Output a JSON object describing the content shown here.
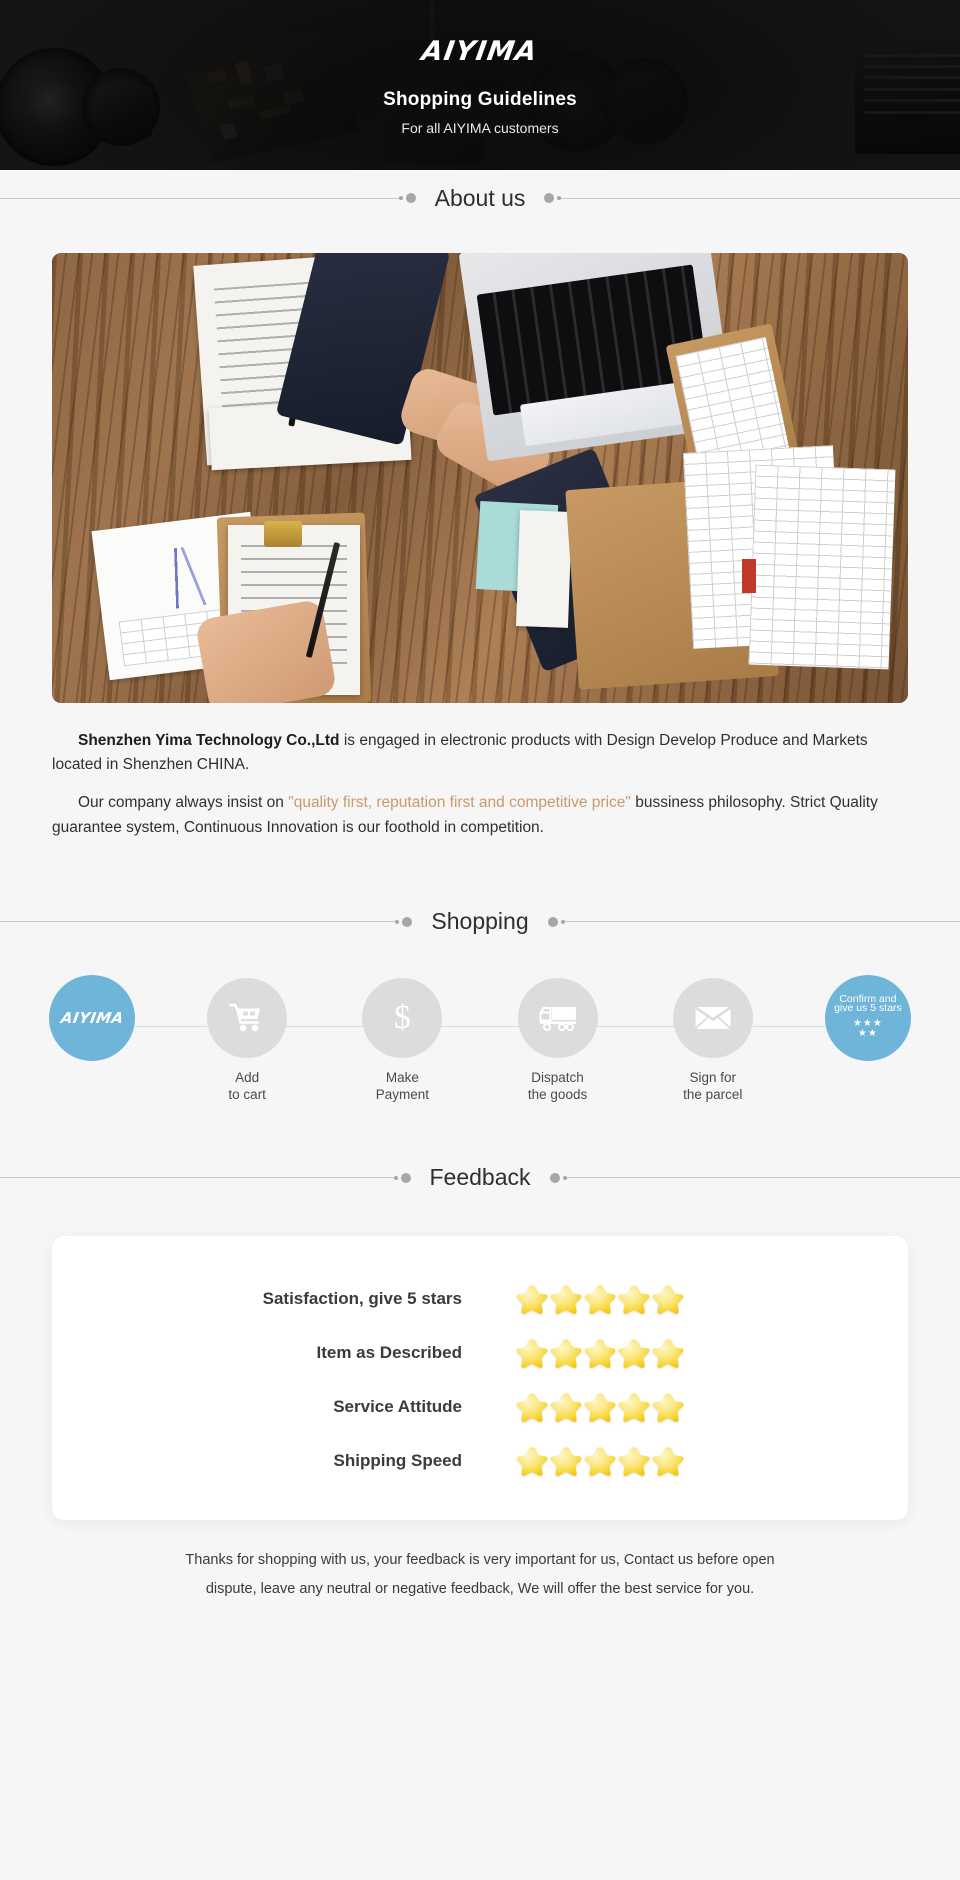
{
  "hero": {
    "brand": "AIYIMA",
    "title": "Shopping Guidelines",
    "subtitle": "For all AIYIMA customers"
  },
  "sections": {
    "about_title": "About us",
    "shopping_title": "Shopping",
    "feedback_title": "Feedback"
  },
  "about": {
    "paragraph1_company": "Shenzhen Yima Technology Co.,Ltd",
    "paragraph1_rest": " is engaged in electronic products with Design Develop Produce and Markets located in Shenzhen CHINA.",
    "paragraph2_pre": "Our company always insist on ",
    "paragraph2_quote": "\"quality first, reputation first and competitive price\"",
    "paragraph2_post": " bussiness philosophy. Strict Quality guarantee system, Continuous Innovation is our foothold in competition."
  },
  "shopping_steps": [
    {
      "label1": "",
      "label2": "",
      "icon": "aiyima-logo-icon",
      "text": "AIYIMA",
      "accent": true
    },
    {
      "label1": "Add",
      "label2": "to cart",
      "icon": "shopping-cart-icon"
    },
    {
      "label1": "Make",
      "label2": "Payment",
      "icon": "dollar-icon"
    },
    {
      "label1": "Dispatch",
      "label2": "the goods",
      "icon": "truck-icon"
    },
    {
      "label1": "Sign for",
      "label2": "the parcel",
      "icon": "envelope-icon"
    },
    {
      "label1": "",
      "label2": "",
      "icon": "five-star-icon",
      "text_line1": "Confirm and",
      "text_line2": "give us 5 stars",
      "accent": true
    }
  ],
  "feedback_rows": [
    {
      "label": "Satisfaction, give 5 stars",
      "stars": 5
    },
    {
      "label": "Item as Described",
      "stars": 5
    },
    {
      "label": "Service Attitude",
      "stars": 5
    },
    {
      "label": "Shipping Speed",
      "stars": 5
    }
  ],
  "thanks": {
    "line1": "Thanks for shopping with us, your feedback is very important for us, Contact us before open",
    "line2": "dispute, leave any neutral or negative feedback, We will offer the best service for you."
  },
  "colors": {
    "accent_blue": "#6fb5da",
    "star_gold": "#f7cf3a",
    "quote_highlight": "#c99a6a",
    "hero_bg": "#151515",
    "page_bg": "#f6f6f6"
  }
}
